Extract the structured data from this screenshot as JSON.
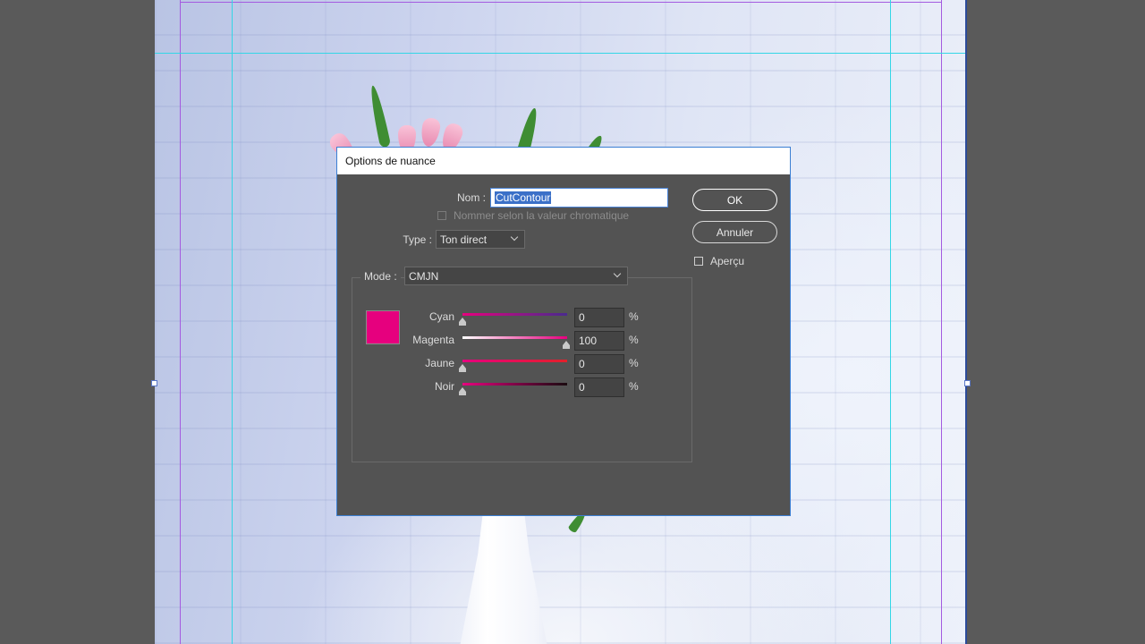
{
  "dialog": {
    "title": "Options de nuance",
    "name_label": "Nom :",
    "name_value": "CutContour",
    "auto_name_label": "Nommer selon la valeur chromatique",
    "type_label": "Type :",
    "type_value": "Ton direct",
    "mode_label": "Mode :",
    "mode_value": "CMJN",
    "ok_label": "OK",
    "cancel_label": "Annuler",
    "preview_label": "Aperçu",
    "swatch_color": "#e6007e",
    "percent_sign": "%",
    "sliders": [
      {
        "label": "Cyan",
        "value": "0"
      },
      {
        "label": "Magenta",
        "value": "100"
      },
      {
        "label": "Jaune",
        "value": "0"
      },
      {
        "label": "Noir",
        "value": "0"
      }
    ]
  },
  "colors": {
    "guide_cyan": "#33d6e6",
    "margin_purple": "#a45be0",
    "dialog_bg": "#535353",
    "accent_blue": "#3b70c8"
  }
}
